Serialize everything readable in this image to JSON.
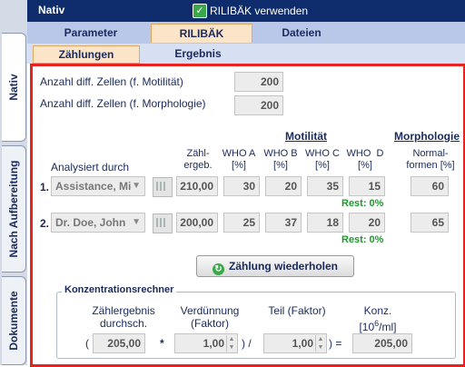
{
  "vtabs": [
    {
      "label": "Nativ"
    },
    {
      "label": "Nach Aufbereitung"
    },
    {
      "label": "Dokumente"
    }
  ],
  "header": {
    "title": "Nativ",
    "checkbox_label": "RILIBÄK verwenden",
    "checkbox_checked": true
  },
  "tabs": [
    "Parameter",
    "RILIBÄK",
    "Dateien"
  ],
  "subtabs": [
    "Zählungen",
    "Ergebnis"
  ],
  "counts": {
    "motility_label": "Anzahl diff. Zellen (f. Motilität)",
    "motility_value": "200",
    "morphology_label": "Anzahl diff. Zellen (f. Morphologie)",
    "morphology_value": "200"
  },
  "table": {
    "group_motility": "Motilität",
    "group_morphology": "Morphologie",
    "col_analyzed": "Analysiert durch",
    "col_count": "Zähl-\nergeb.",
    "col_a": "WHO A\n[%]",
    "col_b": "WHO B\n[%]",
    "col_c": "WHO C\n[%]",
    "col_d": "WHO  D\n[%]",
    "col_normal": "Normal-\nformen [%]",
    "rows": [
      {
        "num": "1.",
        "analyst": "Assistance, Mi",
        "count": "210,00",
        "a": "30",
        "b": "20",
        "c": "35",
        "d": "15",
        "rest": "Rest: 0%",
        "normal": "60"
      },
      {
        "num": "2.",
        "analyst": "Dr. Doe, John",
        "count": "200,00",
        "a": "25",
        "b": "37",
        "c": "18",
        "d": "20",
        "rest": "Rest: 0%",
        "normal": "65"
      }
    ]
  },
  "repeat_button": "Zählung wiederholen",
  "calc": {
    "title": "Konzentrationsrechner",
    "h_count": "Zählergebnis\ndurchsch.",
    "h_dilution": "Verdünnung\n(Faktor)",
    "h_part": "Teil (Faktor)",
    "h_conc_main": "Konz.",
    "h_conc_unit_pre": "[10",
    "h_conc_exp": "6",
    "h_conc_unit_post": "/ml]",
    "open_paren": "(",
    "count_value": "205,00",
    "times": "*",
    "dilution_value": "1,00",
    "close_div": ") /",
    "part_value": "1,00",
    "close_eq": ") =",
    "result_value": "205,00"
  }
}
